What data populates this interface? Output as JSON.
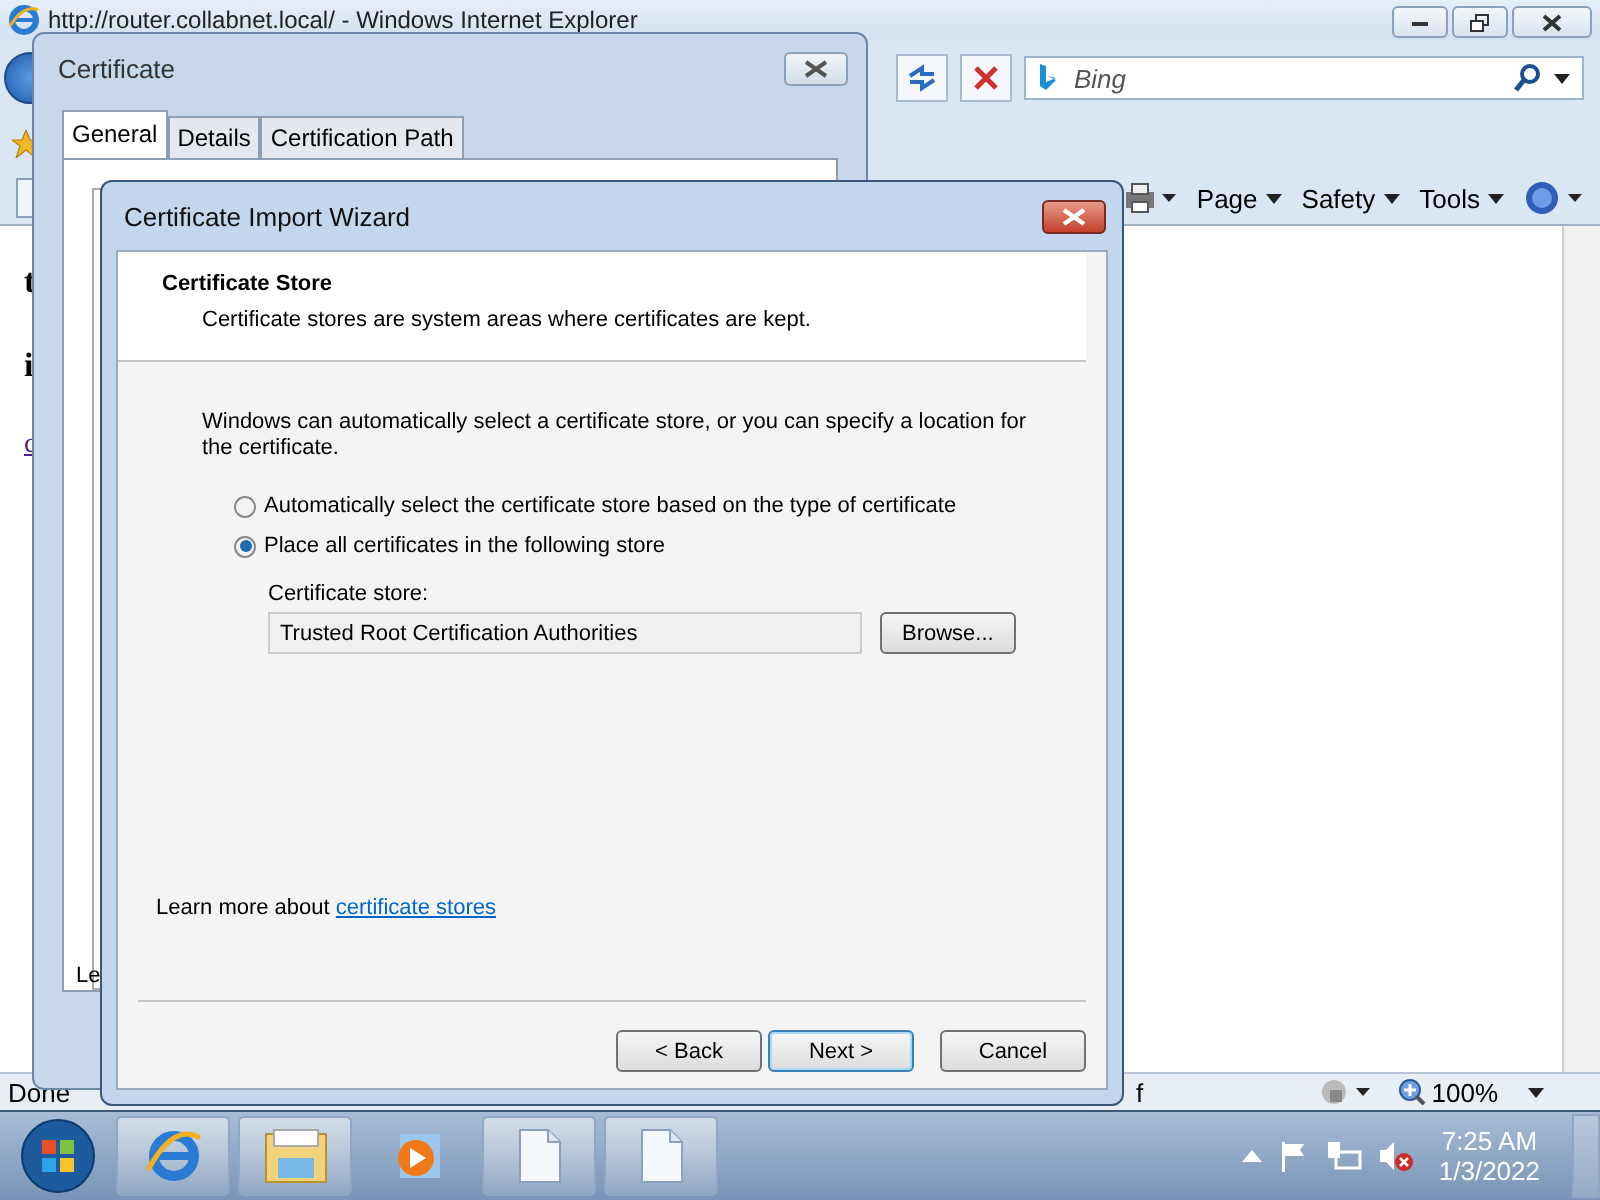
{
  "browser": {
    "title": "http://router.collabnet.local/ - Windows Internet Explorer",
    "search": {
      "placeholder": "Bing"
    },
    "command_bar": [
      {
        "label": "Page"
      },
      {
        "label": "Safety"
      },
      {
        "label": "Tools"
      }
    ],
    "page_text": [
      {
        "kind": "heading",
        "text": "t"
      },
      {
        "kind": "heading",
        "text": "i"
      },
      {
        "kind": "link",
        "text": "c"
      }
    ],
    "status_bar": {
      "status": "Done",
      "text_2": "f",
      "zoom": "100%"
    }
  },
  "certificate_dialog": {
    "title": "Certificate",
    "tabs": [
      {
        "label": "General",
        "selected": true
      },
      {
        "label": "Details",
        "selected": false
      },
      {
        "label": "Certification Path",
        "selected": false
      }
    ],
    "panel_text": "Le"
  },
  "wizard": {
    "title": "Certificate Import Wizard",
    "heading": "Certificate Store",
    "subheading": "Certificate stores are system areas where certificates are kept.",
    "intro": "Windows can automatically select a certificate store, or you can specify a location for the certificate.",
    "options": [
      {
        "label": "Automatically select the certificate store based on the type of certificate",
        "selected": false
      },
      {
        "label": "Place all certificates in the following store",
        "selected": true
      }
    ],
    "store_label": "Certificate store:",
    "store_value": "Trusted Root Certification Authorities",
    "browse": "Browse...",
    "learn_more": {
      "text": "Learn more about",
      "link": "certificate stores"
    },
    "buttons": [
      {
        "label": "< Back"
      },
      {
        "label": "Next >"
      },
      {
        "label": "Cancel"
      }
    ]
  },
  "taskbar": {
    "clock": {
      "time": "7:25 AM",
      "date": "1/3/2022"
    }
  }
}
